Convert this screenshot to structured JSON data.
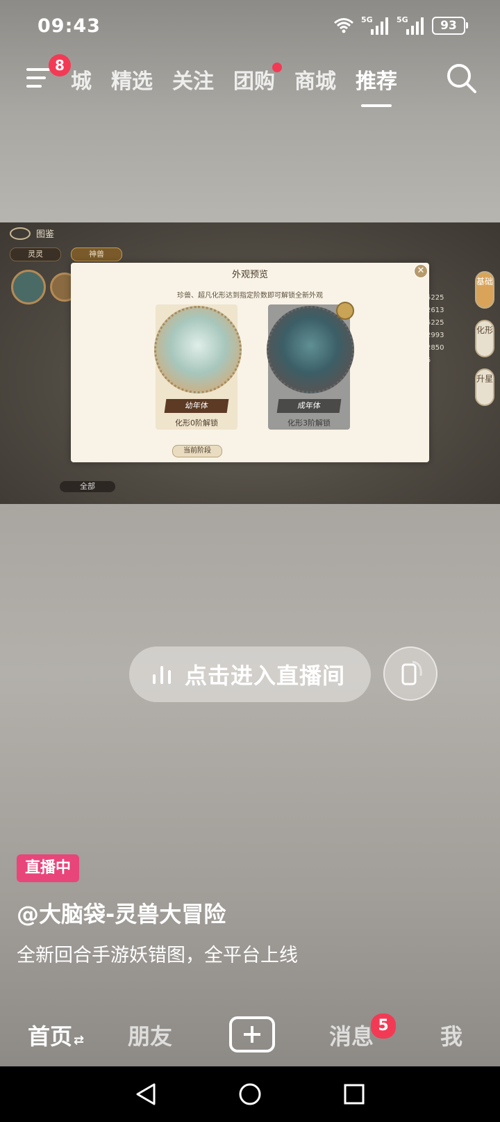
{
  "status_bar": {
    "time": "09:43",
    "signal1_label": "5G",
    "signal2_label": "5G",
    "battery": "93"
  },
  "top_nav": {
    "menu_badge": "8",
    "tabs": [
      "城",
      "精选",
      "关注",
      "团购",
      "商城",
      "推荐"
    ],
    "active_tab": "推荐"
  },
  "game_video": {
    "header": "图鉴",
    "pill_left": "灵灵",
    "pill_right": "神兽",
    "side_tabs": [
      "基础",
      "化形",
      "升星"
    ],
    "stat_numbers": [
      "5225",
      "2613",
      "5225",
      "2993",
      "2850",
      "5"
    ],
    "filter_label": "全部",
    "dialog": {
      "title": "外观预览",
      "subtitle": "珍兽、超凡化形达到指定阶数即可解锁全新外观",
      "cards": [
        {
          "name": "幼年体",
          "condition": "化形0阶解锁"
        },
        {
          "name": "成年体",
          "condition": "化形3阶解锁"
        }
      ],
      "current_stage": "当前阶段"
    }
  },
  "live": {
    "enter_button": "点击进入直播间",
    "badge": "直播中",
    "title": "@大脑袋-灵兽大冒险",
    "description": "全新回合手游妖错图，全平台上线"
  },
  "bottom_nav": {
    "home": "首页",
    "friends": "朋友",
    "messages": "消息",
    "messages_badge": "5",
    "me": "我"
  }
}
